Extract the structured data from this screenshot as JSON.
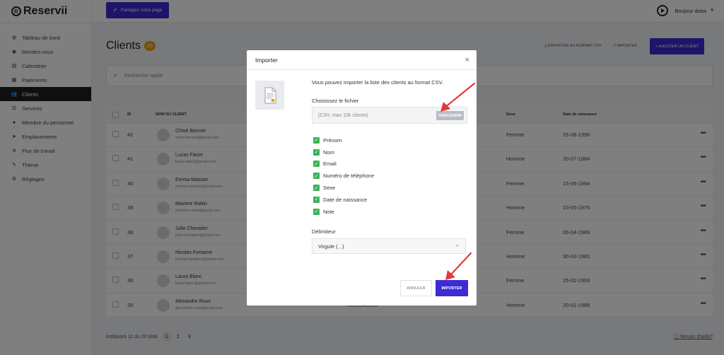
{
  "app": {
    "name": "Reservii"
  },
  "sidebar": {
    "items": [
      {
        "label": "Tableau de bord",
        "icon": "dashboard-icon",
        "glyph": "◍"
      },
      {
        "label": "Rendez-vous",
        "icon": "calendar-check-icon",
        "glyph": "◉"
      },
      {
        "label": "Calendrier",
        "icon": "calendar-icon",
        "glyph": "▤"
      },
      {
        "label": "Paiements",
        "icon": "payments-icon",
        "glyph": "▦"
      },
      {
        "label": "Clients",
        "icon": "users-icon",
        "glyph": "👥",
        "active": true
      },
      {
        "label": "Services",
        "icon": "list-icon",
        "glyph": "☰"
      },
      {
        "label": "Membre du personnel",
        "icon": "person-icon",
        "glyph": "●"
      },
      {
        "label": "Emplacements",
        "icon": "location-arrow-icon",
        "glyph": "➤"
      },
      {
        "label": "Flux de travail",
        "icon": "workflow-icon",
        "glyph": "⋔"
      },
      {
        "label": "Thème",
        "icon": "brush-icon",
        "glyph": "✎"
      },
      {
        "label": "Réglages",
        "icon": "gear-icon",
        "glyph": "⚙"
      }
    ]
  },
  "topbar": {
    "share_label": "Partagez votre page",
    "greeting": "Bonjour deba"
  },
  "page": {
    "title": "Clients",
    "count": "20",
    "export_label": "EXPORTER AU FORMAT CSV",
    "import_label": "IMPORTER",
    "add_label": "+ AJOUTER UN CLIENT",
    "search_placeholder": "Recherche rapide"
  },
  "table": {
    "headers": {
      "id": "ID",
      "name": "NOM DU CLIENT",
      "sex": "Sexe",
      "dob": "Date de naissance"
    },
    "rows": [
      {
        "id": "42",
        "name": "Chloé Bonnet",
        "email": "chloe.bonnet@gmail.com",
        "phone": "",
        "dash": "",
        "sex": "Femme",
        "dob": "25-08-1996"
      },
      {
        "id": "41",
        "name": "Lucas Faure",
        "email": "lucas.faure@gmail.com",
        "phone": "",
        "dash": "",
        "sex": "Homme",
        "dob": "20-07-1984"
      },
      {
        "id": "40",
        "name": "Emma Masson",
        "email": "emma.masson@gmail.com",
        "phone": "",
        "dash": "",
        "sex": "Femme",
        "dob": "15-06-1994"
      },
      {
        "id": "39",
        "name": "Maxime Robin",
        "email": "maxime.robin@gmail.com",
        "phone": "",
        "dash": "",
        "sex": "Homme",
        "dob": "10-05-1976"
      },
      {
        "id": "38",
        "name": "Julie Chevalier",
        "email": "julie.chevalier@gmail.com",
        "phone": "",
        "dash": "",
        "sex": "Femme",
        "dob": "05-04-1989"
      },
      {
        "id": "37",
        "name": "Nicolas Fontaine",
        "email": "nicolas.fontaine@gmail.com",
        "phone": "",
        "dash": "",
        "sex": "Homme",
        "dob": "30-03-1981"
      },
      {
        "id": "36",
        "name": "Laura Blanc",
        "email": "laura.blanc@gmail.com",
        "phone": "",
        "dash": "",
        "sex": "Femme",
        "dob": "25-02-1993"
      },
      {
        "id": "35",
        "name": "Alexandre Roux",
        "email": "alexandre.roux@gmail.com",
        "phone": "+0612345690",
        "dash": "-",
        "sex": "Homme",
        "dob": "20-01-1986"
      }
    ]
  },
  "pagination": {
    "summary": "Indiquant 11 du 20 total",
    "pages": [
      "1",
      "2",
      "3"
    ],
    "help": "Besoin d'aide?"
  },
  "modal": {
    "title": "Importer",
    "intro": "Vous pouvez importer la liste des clients au format CSV.",
    "file_label": "Choisissez le fichier",
    "file_placeholder": "(CSV, max 10k clients)",
    "browse_label": "PARCOURIR",
    "fields": [
      "Prénom",
      "Nom",
      "Email",
      "Numéro de téléphone",
      "Sexe",
      "Date de naissance",
      "Note"
    ],
    "delimiter_label": "Délimiteur",
    "delimiter_value": "Virgule ( , )",
    "cancel_label": "ANNULER",
    "import_label": "IMPORTER"
  },
  "colors": {
    "accent": "#3d2bd6",
    "check": "#3fb158",
    "arrow": "#e03a3a",
    "badge": "#e8a317"
  }
}
